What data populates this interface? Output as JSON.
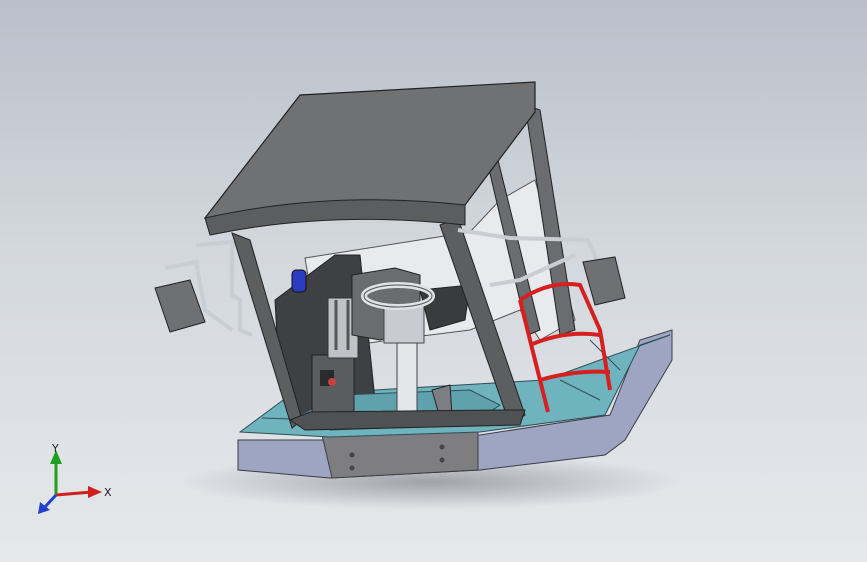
{
  "viewport": {
    "background_top": "#b9c0c9",
    "background_bottom": "#e6e8eb"
  },
  "triad": {
    "x_label": "X",
    "y_label": "Y",
    "x_color": "#d02020",
    "y_color": "#20a020",
    "z_color": "#2040d0"
  },
  "model": {
    "roof_color": "#6f7173",
    "frame_color": "#5c5e60",
    "floor_color": "#6fb3bf",
    "base_color": "#9ea5c2",
    "railing_color": "#d62020",
    "handrail_color": "#c9cdd4"
  }
}
